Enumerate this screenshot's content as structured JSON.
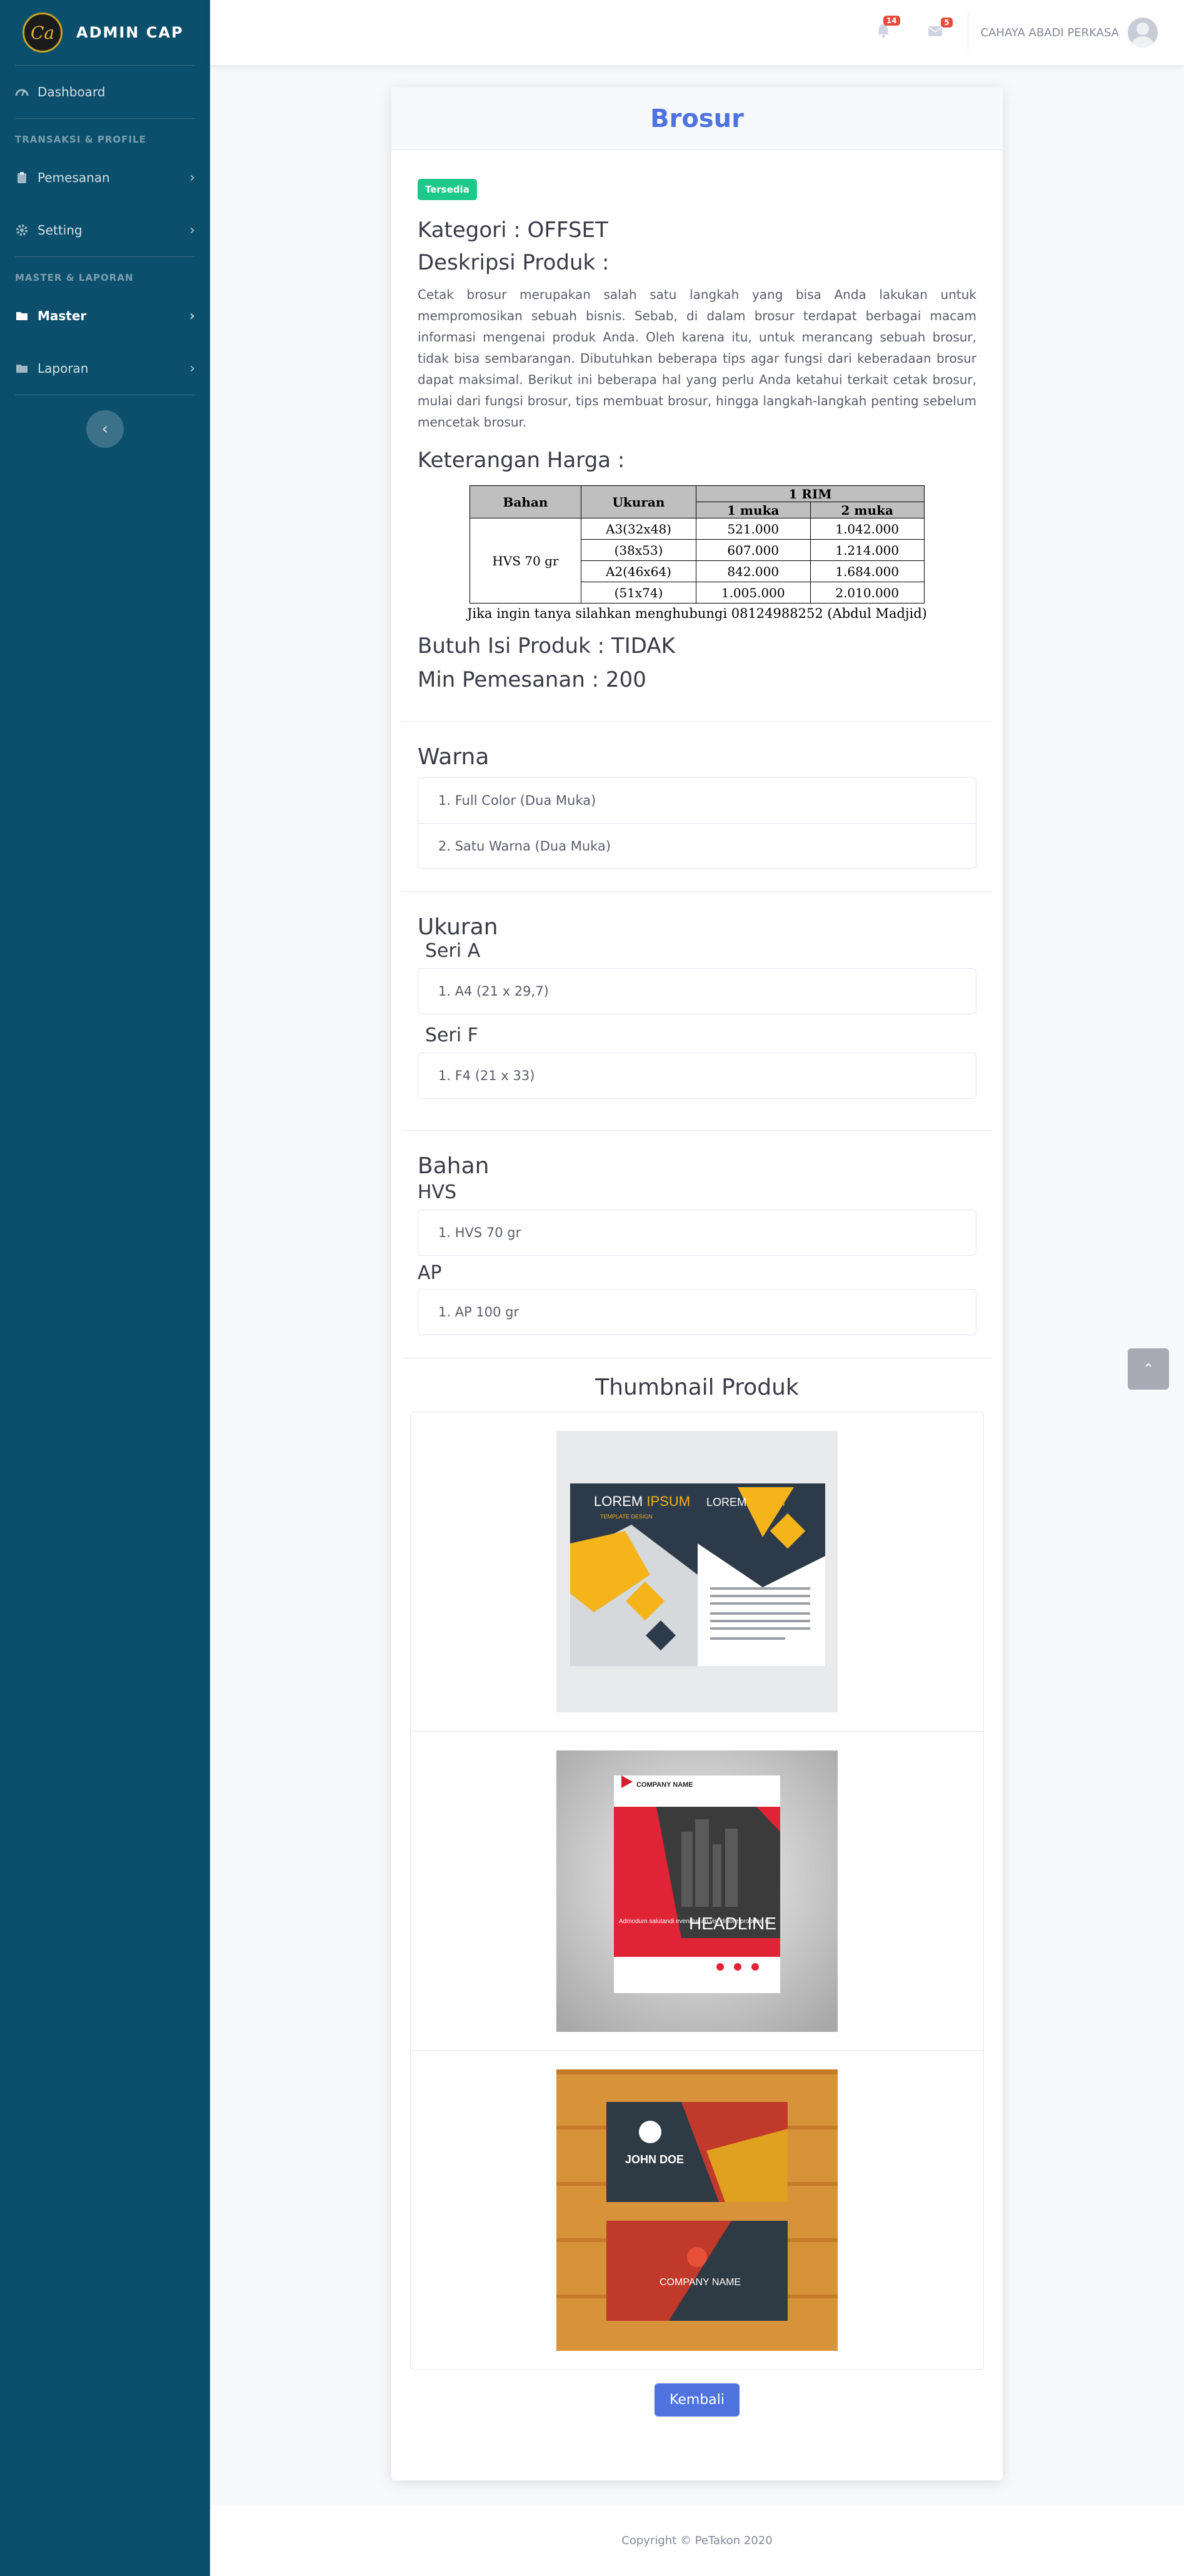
{
  "brand": {
    "name": "ADMIN CAP",
    "logo_text": "Ca"
  },
  "sidebar": {
    "dashboard": "Dashboard",
    "heading_transaksi": "TRANSAKSI & PROFILE",
    "pemesanan": "Pemesanan",
    "setting": "Setting",
    "heading_master": "MASTER & LAPORAN",
    "master": "Master",
    "laporan": "Laporan"
  },
  "topbar": {
    "alerts_count": "14",
    "messages_count": "5",
    "user_name": "CAHAYA ABADI PERKASA"
  },
  "product": {
    "title": "Brosur",
    "status": "Tersedia",
    "kategori": "Kategori : OFFSET",
    "deskripsi_label": "Deskripsi Produk :",
    "deskripsi": "Cetak brosur merupakan salah satu langkah yang bisa Anda lakukan untuk mempromosikan sebuah bisnis. Sebab, di dalam brosur terdapat berbagai macam informasi mengenai produk Anda. Oleh karena itu, untuk merancang sebuah brosur, tidak bisa sembarangan. Dibutuhkan beberapa tips agar fungsi dari keberadaan brosur dapat maksimal. Berikut ini beberapa hal yang perlu Anda ketahui terkait cetak brosur, mulai dari fungsi brosur, tips membuat brosur, hingga langkah-langkah penting sebelum mencetak brosur.",
    "harga_label": "Keterangan Harga :",
    "butuh_isi": "Butuh Isi Produk : TIDAK",
    "min_pemesanan": "Min Pemesanan : 200"
  },
  "price_table": {
    "h_bahan": "Bahan",
    "h_ukuran": "Ukuran",
    "h_rim": "1 RIM",
    "h_1muka": "1 muka",
    "h_2muka": "2 muka",
    "bahan": "HVS 70 gr",
    "rows": [
      {
        "ukuran": "A3(32x48)",
        "satu": "521.000",
        "dua": "1.042.000"
      },
      {
        "ukuran": "(38x53)",
        "satu": "607.000",
        "dua": "1.214.000"
      },
      {
        "ukuran": "A2(46x64)",
        "satu": "842.000",
        "dua": "1.684.000"
      },
      {
        "ukuran": "(51x74)",
        "satu": "1.005.000",
        "dua": "2.010.000"
      }
    ],
    "note": "Jika ingin tanya silahkan menghubungi 08124988252 (Abdul Madjid)"
  },
  "warna": {
    "title": "Warna",
    "items": [
      "1. Full Color (Dua Muka)",
      "2. Satu Warna (Dua Muka)"
    ]
  },
  "ukuran": {
    "title": "Ukuran",
    "seri_a": "Seri A",
    "seri_a_item": "1. A4 (21 x 29,7)",
    "seri_f": "Seri F",
    "seri_f_item": "1. F4 (21 x 33)"
  },
  "bahan": {
    "title": "Bahan",
    "hvs": "HVS",
    "hvs_item": "1. HVS 70 gr",
    "ap": "AP",
    "ap_item": "1. AP 100 gr"
  },
  "thumbnails": {
    "title": "Thumbnail Produk",
    "t1_left": "LOREM",
    "t1_left_b": "IPSUM",
    "t1_sub": "TEMPLATE DESIGN",
    "t2_company": "COMPANY NAME",
    "t2_headline": "HEADLINE",
    "t2_side": "Admodum salutandi eveniltur an vis, dolore propriae ei.",
    "t3_name": "JOHN DOE",
    "t3_company": "COMPANY NAME"
  },
  "back_button": "Kembali",
  "footer": "Copyright © PeTakon 2020"
}
